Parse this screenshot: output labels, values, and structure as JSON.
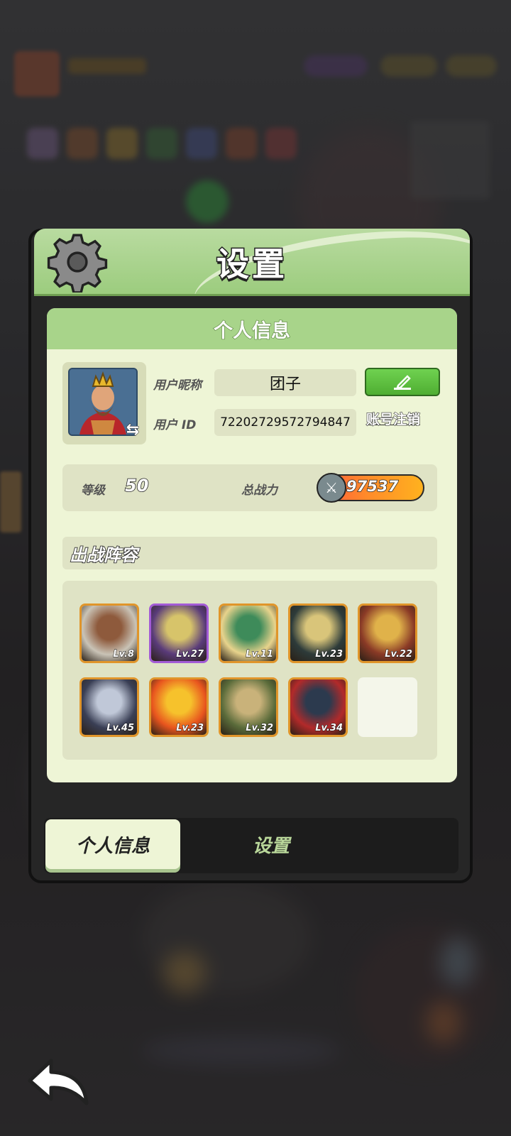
{
  "panel": {
    "title": "设置"
  },
  "profile_section": {
    "header": "个人信息",
    "nickname_label": "用户昵称",
    "nickname_value": "团子",
    "id_label": "用户 ID",
    "id_value": "72202729572794847",
    "cancel_account_label": "账号注销"
  },
  "stats": {
    "level_label": "等级",
    "level_value": "50",
    "power_label": "总战力",
    "power_value": "97537"
  },
  "lineup": {
    "header": "出战阵容",
    "heroes": [
      {
        "level": "Lv.8",
        "frame": "orange",
        "colors": [
          "#c9c3b6",
          "#8e5a3c"
        ]
      },
      {
        "level": "Lv.27",
        "frame": "purple",
        "colors": [
          "#5a3b7a",
          "#d7c46a"
        ]
      },
      {
        "level": "Lv.11",
        "frame": "orange",
        "colors": [
          "#e8d38c",
          "#3e8b5a"
        ]
      },
      {
        "level": "Lv.23",
        "frame": "orange",
        "colors": [
          "#2d3b3a",
          "#d9c57a"
        ]
      },
      {
        "level": "Lv.22",
        "frame": "orange",
        "colors": [
          "#8a3a26",
          "#e0b24a"
        ]
      },
      {
        "level": "Lv.45",
        "frame": "orange",
        "colors": [
          "#3a3f55",
          "#c0c8d8"
        ]
      },
      {
        "level": "Lv.23",
        "frame": "orange",
        "colors": [
          "#e8551e",
          "#f6c22c"
        ]
      },
      {
        "level": "Lv.32",
        "frame": "orange",
        "colors": [
          "#5a6b3a",
          "#c9b27a"
        ]
      },
      {
        "level": "Lv.34",
        "frame": "orange",
        "colors": [
          "#b22a2a",
          "#2c3a4e"
        ]
      },
      {
        "level": "",
        "frame": "empty",
        "colors": [
          "#f4f6ea",
          "#f4f6ea"
        ]
      }
    ]
  },
  "tabs": {
    "active": "个人信息",
    "other": "设置"
  },
  "colors": {
    "header_green": "#9ccc7e",
    "panel_cream": "#eef5d6",
    "edit_button_green": "#4fae32"
  }
}
